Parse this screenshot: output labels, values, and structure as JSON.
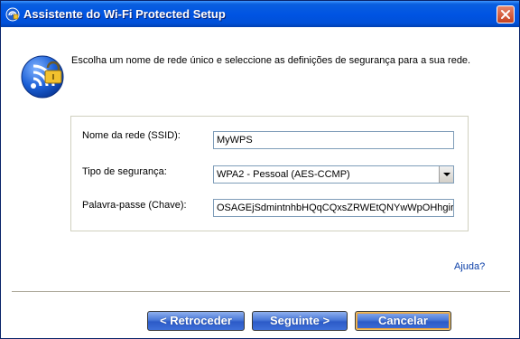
{
  "window": {
    "title": "Assistente do Wi-Fi Protected Setup"
  },
  "intro_text": "Escolha um nome de rede único e seleccione as definições de segurança para a sua rede.",
  "form": {
    "ssid": {
      "label": "Nome da rede (SSID):",
      "value": "MyWPS"
    },
    "security_type": {
      "label": "Tipo de segurança:",
      "selected": "WPA2 - Pessoal (AES-CCMP)"
    },
    "passphrase": {
      "label": "Palavra-passe (Chave):",
      "value": "OSAGEjSdmintnhbHQqCQxsZRWEtQNYwWpOHhgirB"
    }
  },
  "help_link": "Ajuda?",
  "buttons": {
    "back": "< Retroceder",
    "next": "Seguinte >",
    "cancel": "Cancelar"
  },
  "icons": {
    "title": "wps-app-icon",
    "main": "wifi-lock-icon",
    "close": "close-icon"
  },
  "colors": {
    "titlebar": "#0054e3",
    "button": "#3e6fd8",
    "close": "#c4401f",
    "link": "#0b3fa8"
  }
}
